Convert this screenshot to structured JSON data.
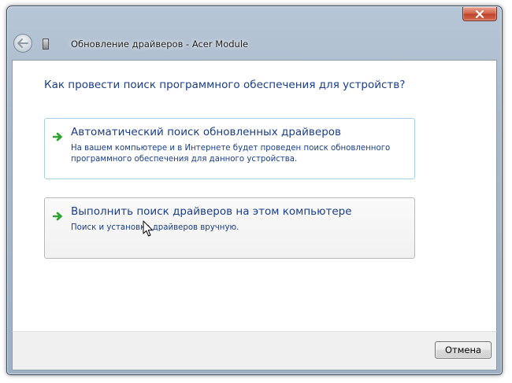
{
  "window": {
    "title": "Обновление драйверов - Acer Module"
  },
  "titlebar": {
    "back_icon": "back-arrow-icon",
    "device_icon": "device-icon",
    "close_icon": "close-icon"
  },
  "main": {
    "question": "Как провести поиск программного обеспечения для устройств?",
    "options": [
      {
        "title": "Автоматический поиск обновленных драйверов",
        "description_lines": [
          "На вашем компьютере и в Интернете будет проведен поиск обновленного",
          "программного обеспечения для данного устройства."
        ],
        "icon": "green-arrow-icon"
      },
      {
        "title": "Выполнить поиск драйверов на этом компьютере",
        "description_lines": [
          "Поиск и установка драйверов вручную."
        ],
        "icon": "green-arrow-icon"
      }
    ]
  },
  "footer": {
    "cancel_label": "Отмена"
  },
  "colors": {
    "link_blue": "#1a3e8c",
    "arrow_green": "#2fa32f",
    "option_hover_border": "#a6d2ea"
  }
}
